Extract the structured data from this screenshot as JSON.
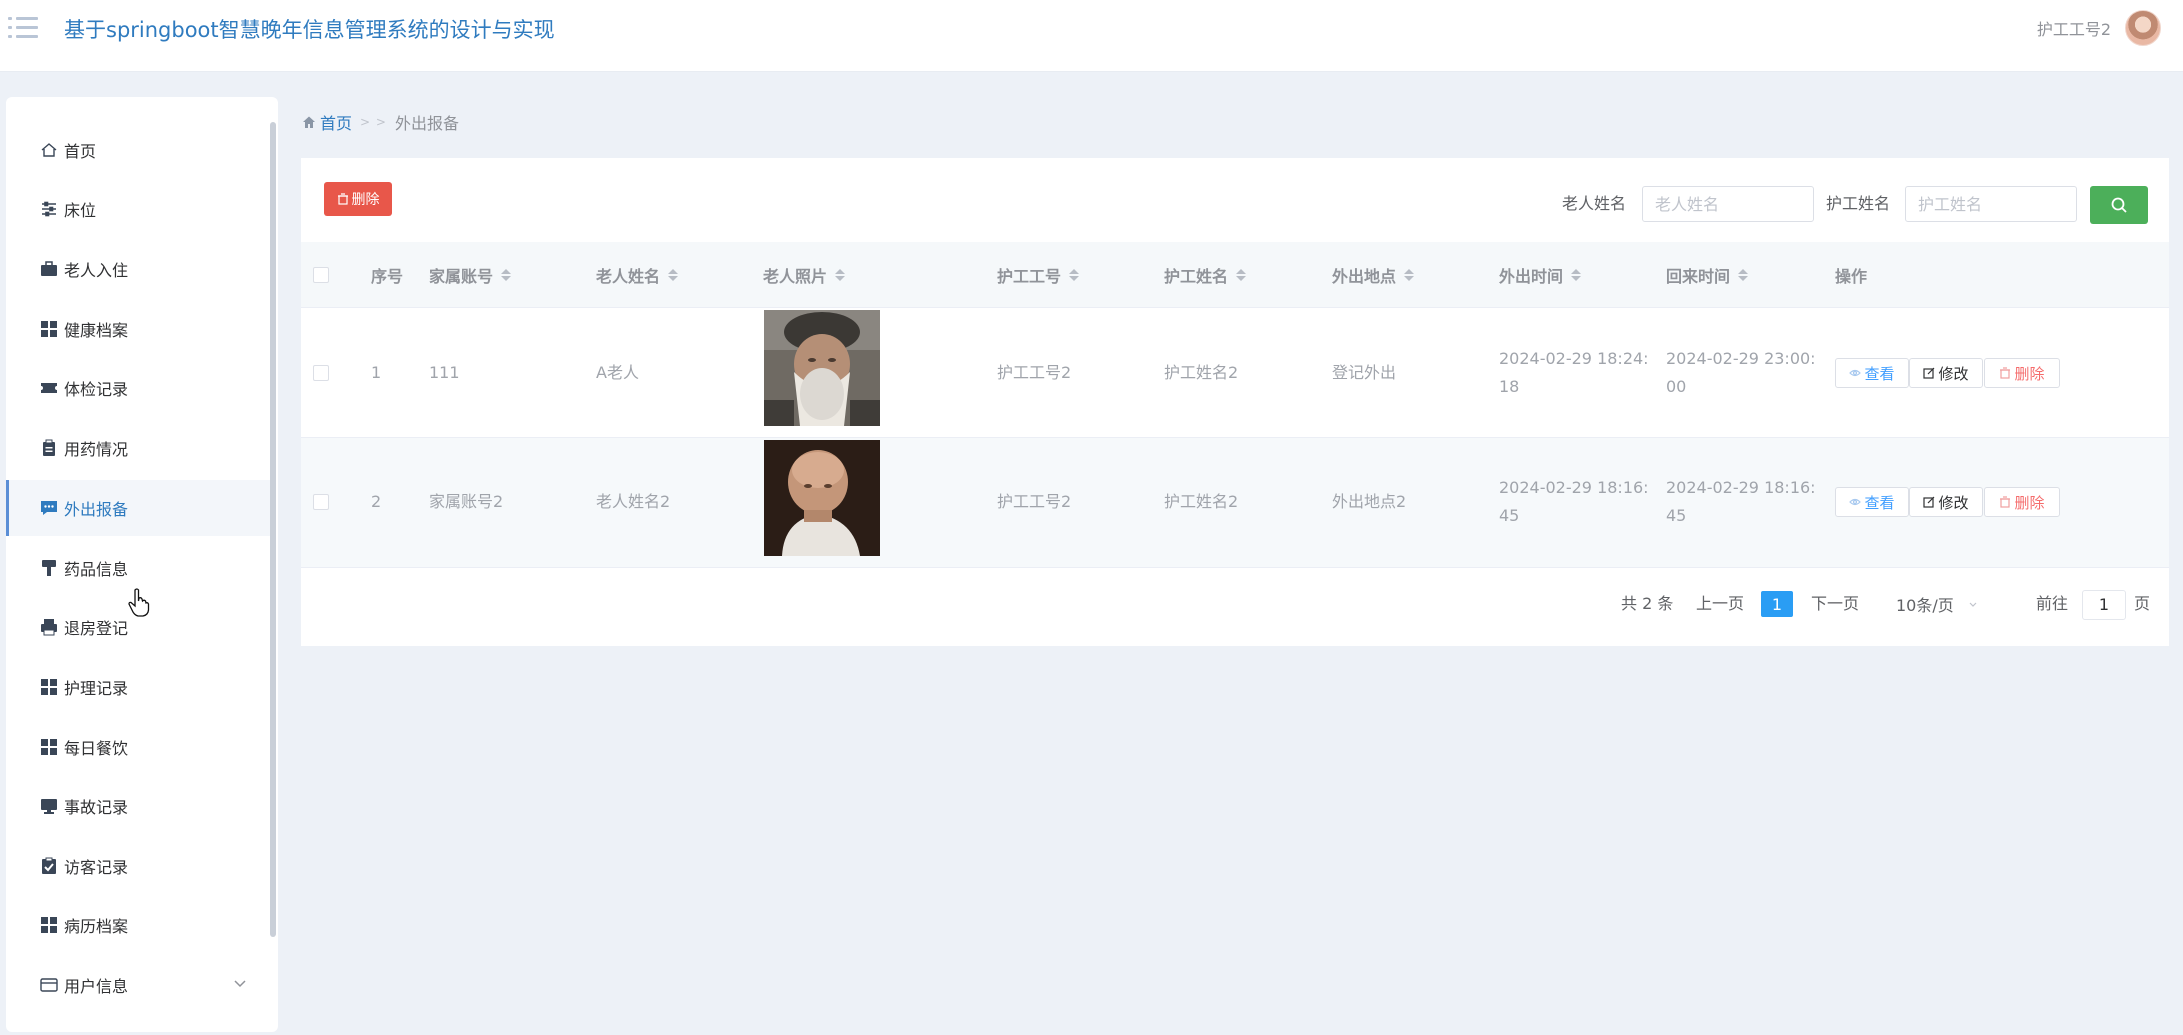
{
  "header": {
    "title": "基于springboot智慧晚年信息管理系统的设计与实现",
    "user_name": "护工工号2"
  },
  "sidebar": {
    "items": [
      {
        "label": "首页",
        "icon": "home-icon"
      },
      {
        "label": "床位",
        "icon": "sliders-icon"
      },
      {
        "label": "老人入住",
        "icon": "briefcase-icon"
      },
      {
        "label": "健康档案",
        "icon": "grid-icon"
      },
      {
        "label": "体检记录",
        "icon": "ticket-icon"
      },
      {
        "label": "用药情况",
        "icon": "clipboard-icon"
      },
      {
        "label": "外出报备",
        "icon": "chat-icon"
      },
      {
        "label": "药品信息",
        "icon": "brush-icon"
      },
      {
        "label": "退房登记",
        "icon": "printer-icon"
      },
      {
        "label": "护理记录",
        "icon": "grid-icon"
      },
      {
        "label": "每日餐饮",
        "icon": "grid-icon"
      },
      {
        "label": "事故记录",
        "icon": "monitor-icon"
      },
      {
        "label": "访客记录",
        "icon": "checklist-icon"
      },
      {
        "label": "病历档案",
        "icon": "grid-icon"
      },
      {
        "label": "用户信息",
        "icon": "wallet-icon"
      }
    ],
    "active_index": 6
  },
  "breadcrumb": {
    "home": "首页",
    "separator": "> >",
    "current": "外出报备"
  },
  "toolbar": {
    "delete_label": "删除",
    "elder_name_label": "老人姓名",
    "elder_name_placeholder": "老人姓名",
    "nurse_name_label": "护工姓名",
    "nurse_name_placeholder": "护工姓名"
  },
  "table": {
    "columns": [
      "序号",
      "家属账号",
      "老人姓名",
      "老人照片",
      "护工工号",
      "护工姓名",
      "外出地点",
      "外出时间",
      "回来时间",
      "操作"
    ],
    "rows": [
      {
        "index": "1",
        "family_account": "111",
        "elder_name": "A老人",
        "nurse_no": "护工工号2",
        "nurse_name": "护工姓名2",
        "location": "登记外出",
        "out_time_line1": "2024-02-29 18:24:",
        "out_time_line2": "18",
        "return_time_line1": "2024-02-29 23:00:",
        "return_time_line2": "00"
      },
      {
        "index": "2",
        "family_account": "家属账号2",
        "elder_name": "老人姓名2",
        "nurse_no": "护工工号2",
        "nurse_name": "护工姓名2",
        "location": "外出地点2",
        "out_time_line1": "2024-02-29 18:16:",
        "out_time_line2": "45",
        "return_time_line1": "2024-02-29 18:16:",
        "return_time_line2": "45"
      }
    ],
    "actions": {
      "view": "查看",
      "edit": "修改",
      "delete": "删除"
    }
  },
  "pagination": {
    "total": "共 2 条",
    "prev": "上一页",
    "current_page": "1",
    "next": "下一页",
    "page_size": "10条/页",
    "goto_label": "前往",
    "goto_value": "1",
    "page_suffix": "页"
  },
  "colors": {
    "primary": "#2f7bbf",
    "danger": "#e8574a",
    "success": "#4caf5a",
    "page_active": "#2a9df4"
  }
}
